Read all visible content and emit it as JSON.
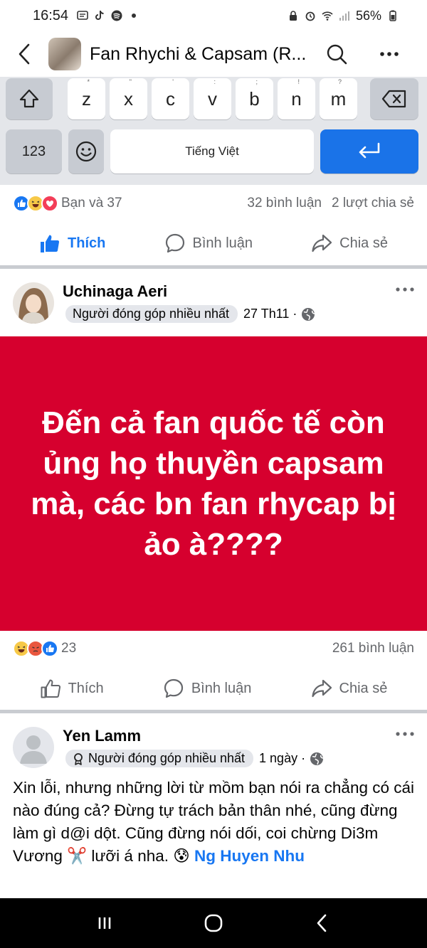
{
  "status_bar": {
    "time": "16:54",
    "battery": "56%"
  },
  "header": {
    "title": "Fan Rhychi & Capsam (R..."
  },
  "keyboard": {
    "row1": [
      {
        "key": "z",
        "hint": "*"
      },
      {
        "key": "x",
        "hint": "\""
      },
      {
        "key": "c",
        "hint": "'"
      },
      {
        "key": "v",
        "hint": ":"
      },
      {
        "key": "b",
        "hint": ";"
      },
      {
        "key": "n",
        "hint": "!"
      },
      {
        "key": "m",
        "hint": "?"
      }
    ],
    "numbers_label": "123",
    "space_label": "Tiếng Việt"
  },
  "top_post": {
    "reactions_label": "Bạn và 37",
    "comments": "32 bình luận",
    "shares": "2 lượt chia sẻ",
    "like_label": "Thích",
    "comment_label": "Bình luận",
    "share_label": "Chia sẻ"
  },
  "post1": {
    "author": "Uchinaga Aeri",
    "badge": "Người đóng góp nhiều nhất",
    "time": "27 Th11 ·",
    "banner_text": "Đến cả fan quốc tế còn ủng họ thuyền capsam mà, các bn fan rhycap bị ảo à????",
    "reaction_count": "23",
    "comments": "261 bình luận",
    "like_label": "Thích",
    "comment_label": "Bình luận",
    "share_label": "Chia sẻ"
  },
  "post2": {
    "author": "Yen Lamm",
    "badge": "Người đóng góp nhiều nhất",
    "time": "1 ngày ·",
    "body": "Xin lỗi, nhưng những lời từ mồm bạn nói ra chẳng có cái nào đúng cả? Đừng tự trách bản thân nhé, cũng đừng làm gì d@i dột. Cũng đừng nói dối, coi chừng Di3m Vương ✂️ lưỡi á nha. 😰 ",
    "mention": "Ng Huyen Nhu"
  },
  "colors": {
    "accent": "#1877f2",
    "banner": "#d6002e",
    "secondary_text": "#65676b"
  }
}
